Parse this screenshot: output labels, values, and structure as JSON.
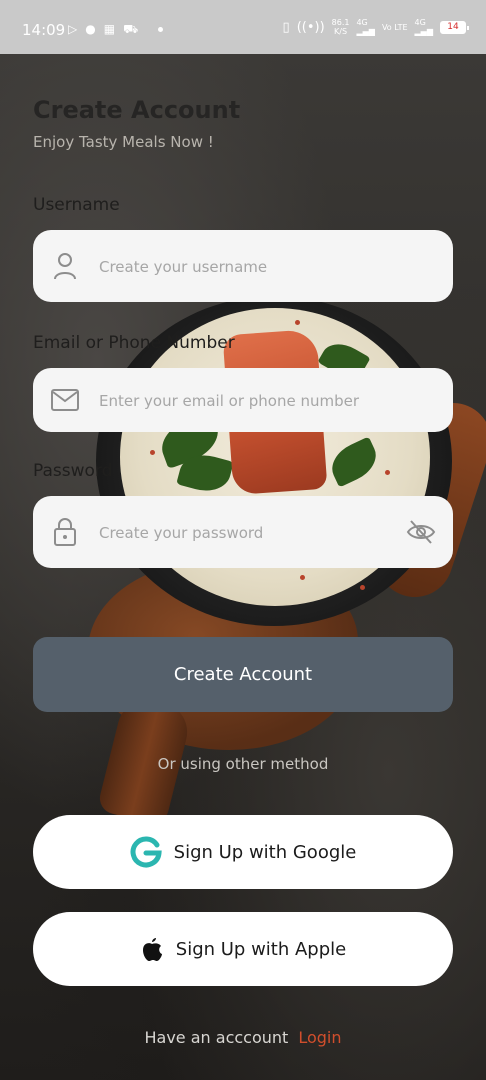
{
  "status_bar": {
    "time": "14:09",
    "net_speed_value": "86.1",
    "net_speed_unit": "K/S",
    "network_1": "4G",
    "network_volte": "Vo LTE",
    "network_2": "4G",
    "battery_level": "14"
  },
  "header": {
    "title": "Create Account",
    "subtitle": "Enjoy Tasty Meals Now !"
  },
  "form": {
    "username": {
      "label": "Username",
      "placeholder": "Create your username",
      "value": ""
    },
    "email": {
      "label": "Email or Phone Number",
      "placeholder": "Enter your email or phone number",
      "value": ""
    },
    "password": {
      "label": "Password",
      "placeholder": "Create your password",
      "value": ""
    },
    "submit_label": "Create Account"
  },
  "alt_methods": {
    "divider_text": "Or using other method",
    "google_label": "Sign Up with Google",
    "apple_label": "Sign Up with Apple"
  },
  "footer": {
    "prompt": "Have an acccount",
    "login_label": "Login"
  },
  "colors": {
    "primary_button": "#55606b",
    "login_link": "#d14e2c",
    "google_icon": "#2bb6b0"
  }
}
